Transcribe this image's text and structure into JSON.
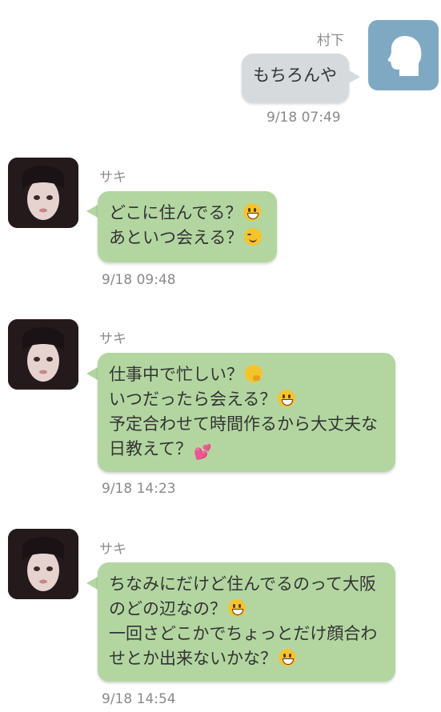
{
  "messages": [
    {
      "sender": "村下",
      "side": "right",
      "lines": [
        {
          "text": "もちろんや",
          "emoji": ""
        }
      ],
      "time": "9/18 07:49"
    },
    {
      "sender": "サキ",
      "side": "left",
      "lines": [
        {
          "text": "どこに住んでる？",
          "emoji": "grinning-face-emoji"
        },
        {
          "text": "あといつ会える？",
          "emoji": "smiling-face-emoji"
        }
      ],
      "time": "9/18 09:48"
    },
    {
      "sender": "サキ",
      "side": "left",
      "lines": [
        {
          "text": "仕事中で忙しい？",
          "emoji": "thinking-face-emoji"
        },
        {
          "text": "いつだったら会える？",
          "emoji": "grinning-face-emoji"
        },
        {
          "text": "予定合わせて時間作るから大丈夫な",
          "emoji": ""
        },
        {
          "text": "日教えて？",
          "emoji": "two-hearts-emoji"
        }
      ],
      "time": "9/18 14:23"
    },
    {
      "sender": "サキ",
      "side": "left",
      "lines": [
        {
          "text": "ちなみにだけど住んでるのって大阪",
          "emoji": ""
        },
        {
          "text": "のどの辺なの？",
          "emoji": "grinning-face-emoji"
        },
        {
          "text": "一回さどこかでちょっとだけ顔合わ",
          "emoji": ""
        },
        {
          "text": "せとか出来ないかな？",
          "emoji": "grinning-face-emoji"
        }
      ],
      "time": "9/18 14:54"
    }
  ],
  "colors": {
    "self_bubble": "#d6dadd",
    "other_bubble": "#b3d6a1",
    "self_avatar": "#7fa9c3",
    "meta_text": "#8a8a8a"
  }
}
